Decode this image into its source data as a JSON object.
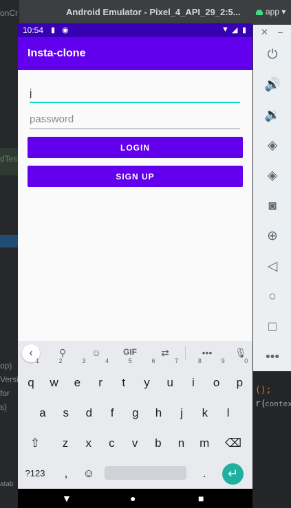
{
  "window": {
    "title": "Android Emulator - Pixel_4_API_29_2:5...",
    "run_config": "app"
  },
  "ide": {
    "left_fragments": [
      "onCr",
      "dTes",
      "op)",
      "Versi",
      "for",
      "s)",
      "atab"
    ],
    "right_fragments": [
      "();",
      "r(",
      "contex"
    ]
  },
  "status_bar": {
    "time": "10:54",
    "notification_icons": [
      "sd-card-icon",
      "at-icon"
    ],
    "right_icons": [
      "wifi-icon",
      "signal-icon",
      "battery-icon"
    ]
  },
  "app_bar": {
    "title": "Insta-clone"
  },
  "form": {
    "email_value": "j",
    "password_placeholder": "password",
    "login_label": "LOGIN",
    "signup_label": "SIGN UP"
  },
  "keyboard": {
    "suggestions": [
      "search-icon",
      "sticker-icon",
      "GIF",
      "translate-icon",
      "more-icon",
      "mic-icon"
    ],
    "gif_label": "GIF",
    "row1": [
      {
        "k": "q",
        "n": "1"
      },
      {
        "k": "w",
        "n": "2"
      },
      {
        "k": "e",
        "n": "3"
      },
      {
        "k": "r",
        "n": "4"
      },
      {
        "k": "t",
        "n": "5"
      },
      {
        "k": "y",
        "n": "6"
      },
      {
        "k": "u",
        "n": "7"
      },
      {
        "k": "i",
        "n": "8"
      },
      {
        "k": "o",
        "n": "9"
      },
      {
        "k": "p",
        "n": "0"
      }
    ],
    "row2": [
      "a",
      "s",
      "d",
      "f",
      "g",
      "h",
      "j",
      "k",
      "l"
    ],
    "row3": [
      "z",
      "x",
      "c",
      "v",
      "b",
      "n",
      "m"
    ],
    "symbols_label": "?123",
    "comma": ",",
    "period": "."
  },
  "accent": {
    "primary": "#6200ee",
    "primary_dark": "#3700b3",
    "teal": "#03dac5"
  }
}
